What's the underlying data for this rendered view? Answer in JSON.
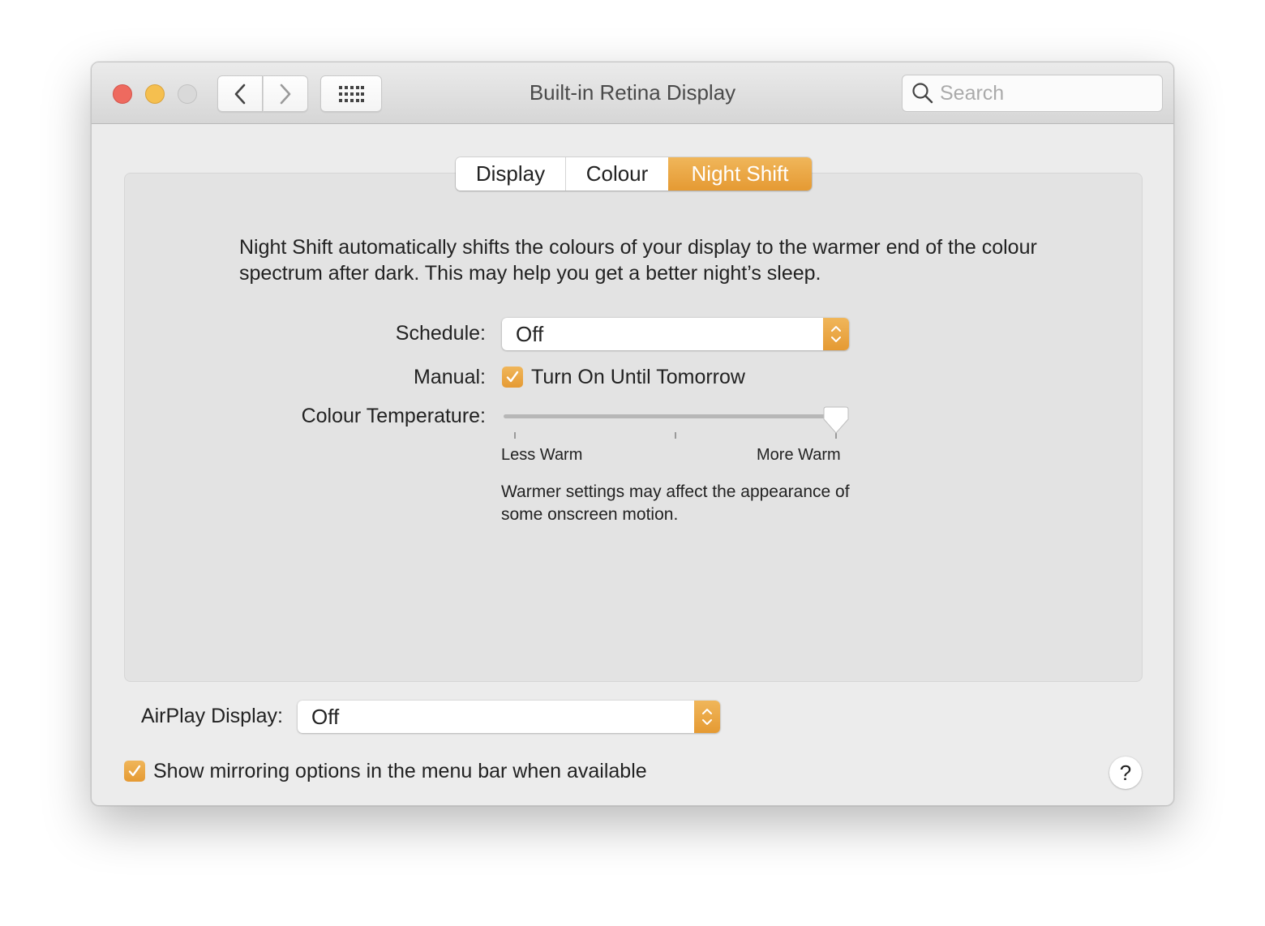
{
  "window": {
    "title": "Built-in Retina Display",
    "traffic_lights": [
      "close",
      "minimize",
      "zoom"
    ]
  },
  "toolbar": {
    "back_icon": "chevron-left-icon",
    "forward_icon": "chevron-right-icon",
    "grid_icon": "show-all-grid-icon",
    "search": {
      "placeholder": "Search",
      "value": ""
    }
  },
  "tabs": [
    {
      "label": "Display",
      "selected": false
    },
    {
      "label": "Colour",
      "selected": false
    },
    {
      "label": "Night Shift",
      "selected": true
    }
  ],
  "night_shift": {
    "description": "Night Shift automatically shifts the colours of your display to the warmer end of the colour spectrum after dark. This may help you get a better night’s sleep.",
    "schedule": {
      "label": "Schedule:",
      "value": "Off"
    },
    "manual": {
      "label": "Manual:",
      "checkbox_label": "Turn On Until Tomorrow",
      "checked": true
    },
    "colour_temperature": {
      "label": "Colour Temperature:",
      "min_label": "Less Warm",
      "max_label": "More Warm",
      "value_fraction": 1.0,
      "note": "Warmer settings may affect the appearance of some onscreen motion."
    }
  },
  "airplay": {
    "label": "AirPlay Display:",
    "value": "Off"
  },
  "mirroring": {
    "label": "Show mirroring options in the menu bar when available",
    "checked": true
  },
  "help": {
    "label": "?"
  },
  "colors": {
    "accent": "#e9a43f",
    "close": "#ee6a5f",
    "minimize": "#f5bf4f"
  }
}
